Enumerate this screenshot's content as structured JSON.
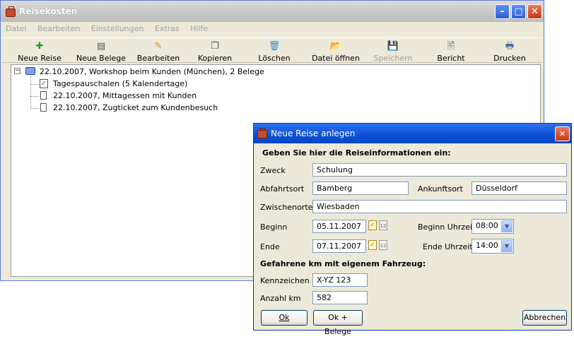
{
  "main": {
    "title": "Reisekosten",
    "menu": [
      "Datei",
      "Bearbeiten",
      "Einstellungen",
      "Extras",
      "Hilfe"
    ],
    "toolbar": [
      {
        "label": "Neue Reise",
        "icon": "plus-icon",
        "glyph": "✚"
      },
      {
        "label": "Neue Belege",
        "icon": "new-document-icon",
        "glyph": "▤"
      },
      {
        "label": "Bearbeiten",
        "icon": "pencil-icon",
        "glyph": "✎"
      },
      {
        "label": "Kopieren",
        "icon": "copy-icon",
        "glyph": "❐"
      },
      {
        "label": "Löschen",
        "icon": "trash-icon",
        "glyph": "🗑"
      },
      {
        "label": "Datei öffnen",
        "icon": "folder-open-icon",
        "glyph": "📂"
      },
      {
        "label": "Speichern",
        "icon": "save-icon",
        "glyph": "💾"
      },
      {
        "label": "Bericht",
        "icon": "report-icon",
        "glyph": "🖹"
      },
      {
        "label": "Drucken",
        "icon": "printer-icon",
        "glyph": "🖶"
      }
    ],
    "tree": {
      "root": "22.10.2007, Workshop beim Kunden (München), 2 Belege",
      "children": [
        "Tagespauschalen (5 Kalendertage)",
        "22.10.2007, Mittagessen mit Kunden",
        "22.10.2007, Zugticket zum Kundenbesuch"
      ]
    }
  },
  "dialog": {
    "title": "Neue Reise anlegen",
    "heading": "Geben Sie hier die Reiseinformationen ein:",
    "zweck_label": "Zweck",
    "zweck_value": "Schulung",
    "abfahrt_label": "Abfahrtsort",
    "abfahrt_value": "Bamberg",
    "ankunft_label": "Ankunftsort",
    "ankunft_value": "Düsseldorf",
    "zwischen_label": "Zwischenorte",
    "zwischen_value": "Wiesbaden",
    "beginn_label": "Beginn",
    "beginn_value": "05.11.2007",
    "beginn_uhrzeit_label": "Beginn Uhrzeit",
    "beginn_uhrzeit_value": "08:00",
    "ende_label": "Ende",
    "ende_value": "07.11.2007",
    "ende_uhrzeit_label": "Ende Uhrzeit",
    "ende_uhrzeit_value": "14:00",
    "km_heading": "Gefahrene km mit eigenem Fahrzeug:",
    "kennzeichen_label": "Kennzeichen",
    "kennzeichen_value": "X-YZ 123",
    "anzahl_label": "Anzahl km",
    "anzahl_value": "582",
    "ok_label": "Ok",
    "ok_belege_label": "Ok + Belege",
    "abbrechen_label": "Abbrechen"
  }
}
